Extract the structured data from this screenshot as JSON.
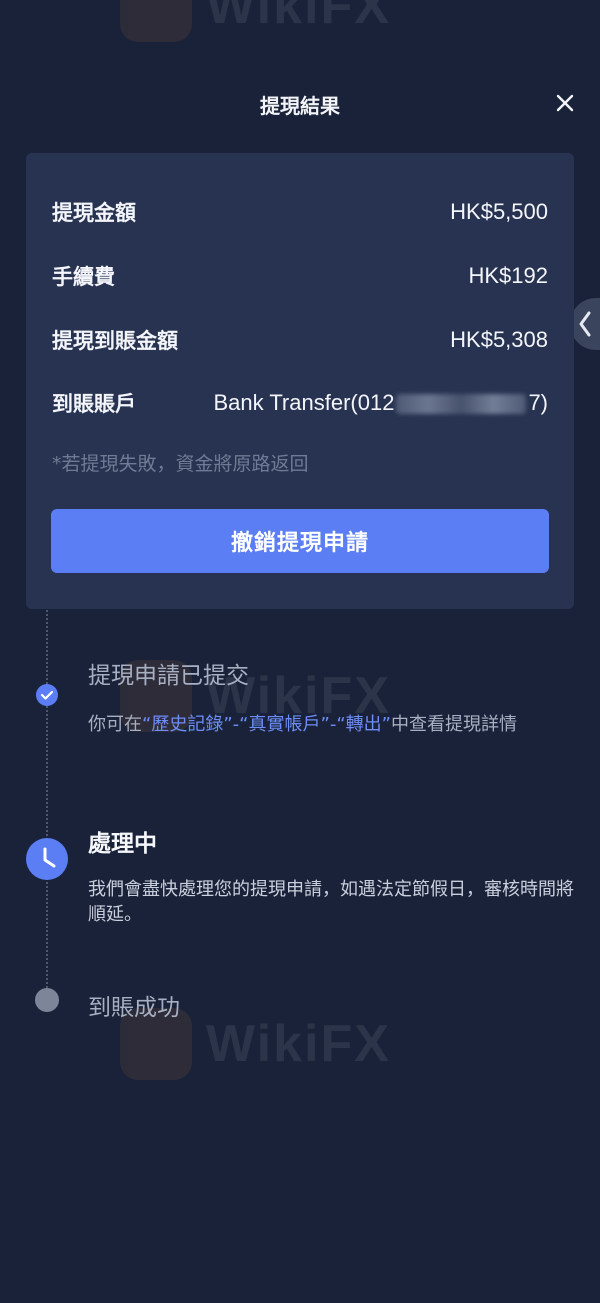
{
  "header": {
    "title": "提現結果"
  },
  "summary": {
    "rows": [
      {
        "label": "提現金額",
        "value": "HK$5,500"
      },
      {
        "label": "手續費",
        "value": "HK$192"
      },
      {
        "label": "提現到賬金額",
        "value": "HK$5,308"
      }
    ],
    "account": {
      "label": "到賬賬戶",
      "value_prefix": "Bank Transfer(012",
      "value_suffix": "7)"
    },
    "note": "*若提現失敗，資金將原路返回",
    "cancel_label": "撤銷提現申請"
  },
  "timeline": {
    "submitted": {
      "title": "提現申請已提交",
      "desc_prefix": "你可在",
      "link_history": "“歷史記錄”",
      "sep1": "-",
      "link_real_account": "“真實帳戶”",
      "sep2": "-",
      "link_transfer_out": "“轉出”",
      "desc_suffix": "中查看提現詳情"
    },
    "processing": {
      "title": "處理中",
      "desc": "我們會盡快處理您的提現申請，如遇法定節假日，審核時間將順延。"
    },
    "completed": {
      "title": "到賬成功"
    }
  },
  "watermark": {
    "text": "WikiFX"
  },
  "colors": {
    "background": "#192238",
    "card": "#273350",
    "accent": "#5b7ef5",
    "link": "#6d8df7",
    "muted": "#6f7a94"
  },
  "icons": {
    "close": "close-icon",
    "side_tab": "chevron-left-icon",
    "step_done": "check-circle-icon",
    "step_processing": "clock-icon",
    "step_pending": "dot-icon"
  }
}
